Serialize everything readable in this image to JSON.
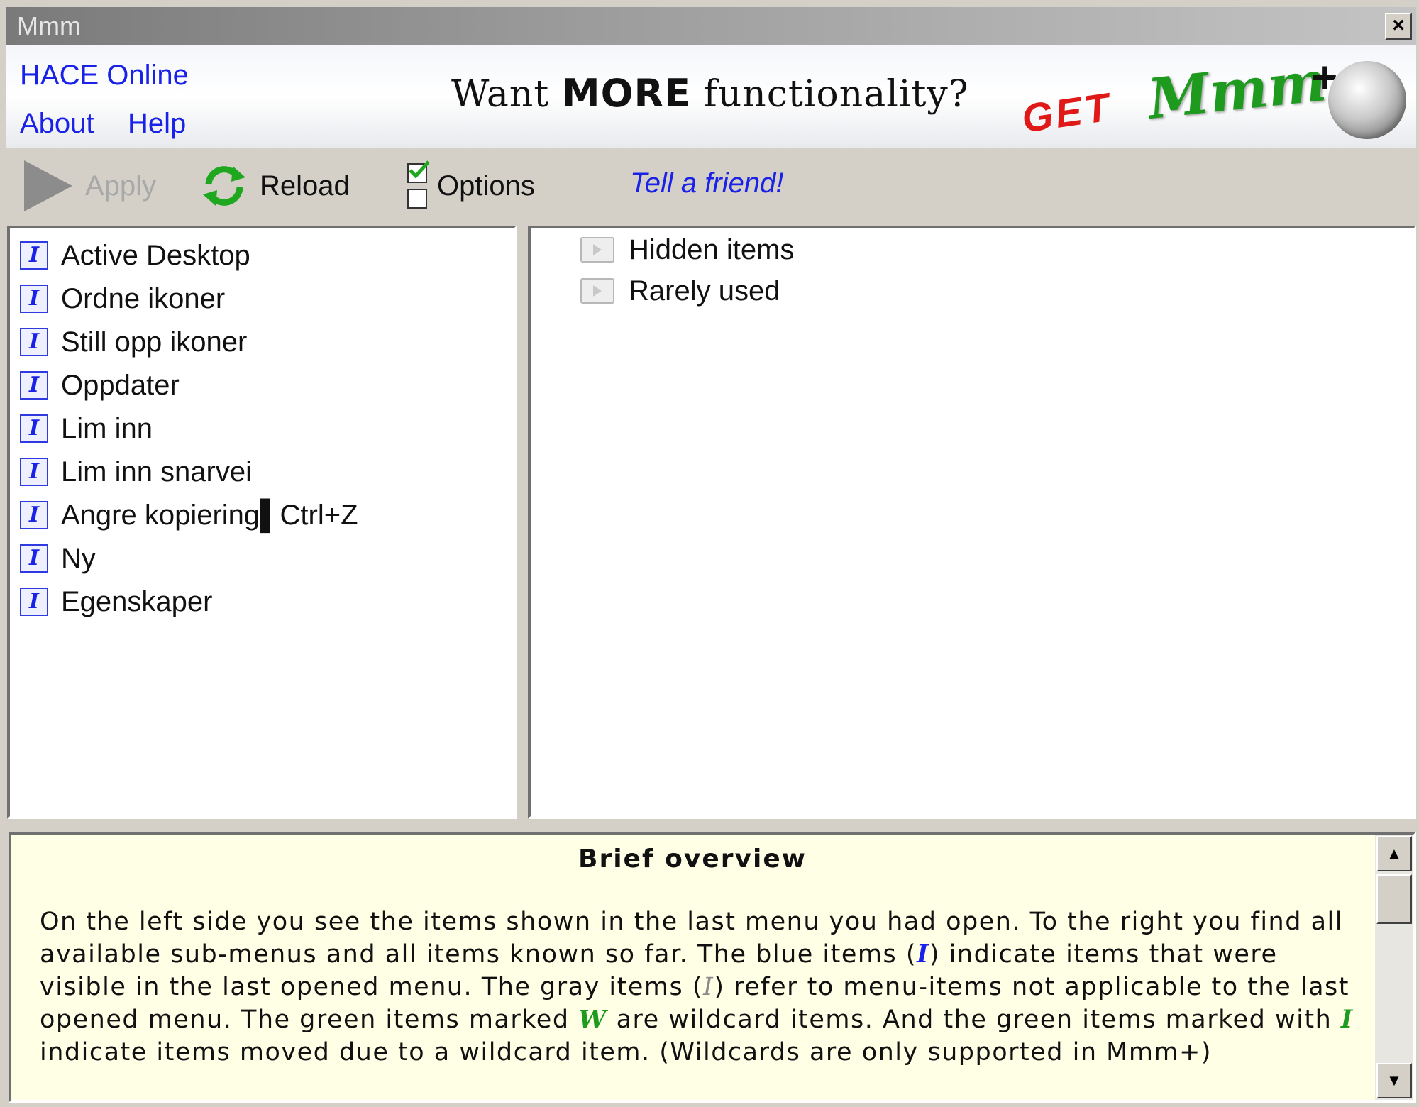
{
  "window": {
    "title": "Mmm",
    "close_symbol": "×"
  },
  "header": {
    "hace_online": "HACE Online",
    "about": "About",
    "help": "Help",
    "promo_prefix": "Want ",
    "promo_more": "MORE",
    "promo_suffix": " functionality?",
    "promo_get": "GET",
    "promo_brand": "Mmm",
    "promo_plus": "+"
  },
  "toolbar": {
    "apply_label": "Apply",
    "apply_enabled": false,
    "reload_label": "Reload",
    "options_label": "Options",
    "tell_friend": "Tell a friend!"
  },
  "left_items": [
    {
      "icon": "I",
      "label": "Active Desktop"
    },
    {
      "icon": "I",
      "label": "Ordne ikoner"
    },
    {
      "icon": "I",
      "label": "Still opp ikoner"
    },
    {
      "icon": "I",
      "label": "Oppdater"
    },
    {
      "icon": "I",
      "label": "Lim inn"
    },
    {
      "icon": "I",
      "label": "Lim inn snarvei"
    },
    {
      "icon": "I",
      "label": "Angre kopiering▌Ctrl+Z"
    },
    {
      "icon": "I",
      "label": "Ny"
    },
    {
      "icon": "I",
      "label": "Egenskaper"
    }
  ],
  "right_items": [
    {
      "label": "Hidden items"
    },
    {
      "label": "Rarely used"
    }
  ],
  "overview": {
    "title": "Brief overview",
    "p1": "On the left side you see the items shown in the last menu you had open. To the right you find all available sub-menus and all items known so far. The blue items (",
    "blue_glyph": "I",
    "p2": ") indicate items that were visible in the last opened menu. The gray items (",
    "gray_glyph": "I",
    "p3": ") refer to menu-items not applicable to the last opened menu. The green items marked ",
    "green_w": "W",
    "p4": " are wildcard items. And the green items marked with ",
    "green_i": "I",
    "p5": " indicate items moved due to a wildcard item. (Wildcards are only supported in Mmm+)"
  },
  "colors": {
    "link": "#1a22e8",
    "promo_red": "#e01818",
    "promo_green": "#1e9a1e",
    "overview_bg": "#ffffe6"
  }
}
